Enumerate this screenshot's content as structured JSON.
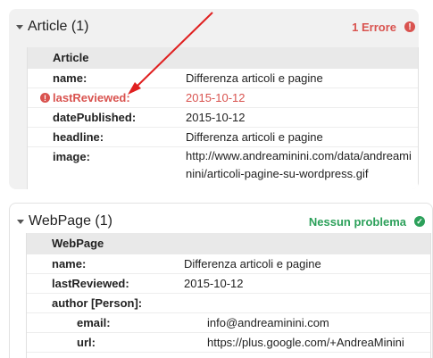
{
  "article": {
    "header_title": "Article (1)",
    "status": "1 Errore",
    "status_icon": "error-icon",
    "panel_title": "Article",
    "rows": [
      {
        "key": "name:",
        "value": "Differenza articoli e pagine"
      },
      {
        "key": "lastReviewed:",
        "value": "2015-10-12",
        "error": true
      },
      {
        "key": "datePublished:",
        "value": "2015-10-12"
      },
      {
        "key": "headline:",
        "value": "Differenza articoli e pagine"
      },
      {
        "key": "image:",
        "value_line1": "http://www.andreaminini.com/data/andreami",
        "value_line2": "nini/articoli-pagine-su-wordpress.gif"
      }
    ]
  },
  "webpage": {
    "header_title": "WebPage (1)",
    "status": "Nessun problema",
    "status_icon": "check-icon",
    "panel_title": "WebPage",
    "rows": [
      {
        "key": "name:",
        "value": "Differenza articoli e pagine"
      },
      {
        "key": "lastReviewed:",
        "value": "2015-10-12"
      },
      {
        "key": "author [Person]:",
        "value": ""
      },
      {
        "key": "email:",
        "value": "info@andreaminini.com"
      },
      {
        "key": "url:",
        "value": "https://plus.google.com/+AndreaMinini"
      }
    ]
  },
  "colors": {
    "error": "#d9534f",
    "ok": "#2ca05a",
    "arrow": "#e02020"
  }
}
